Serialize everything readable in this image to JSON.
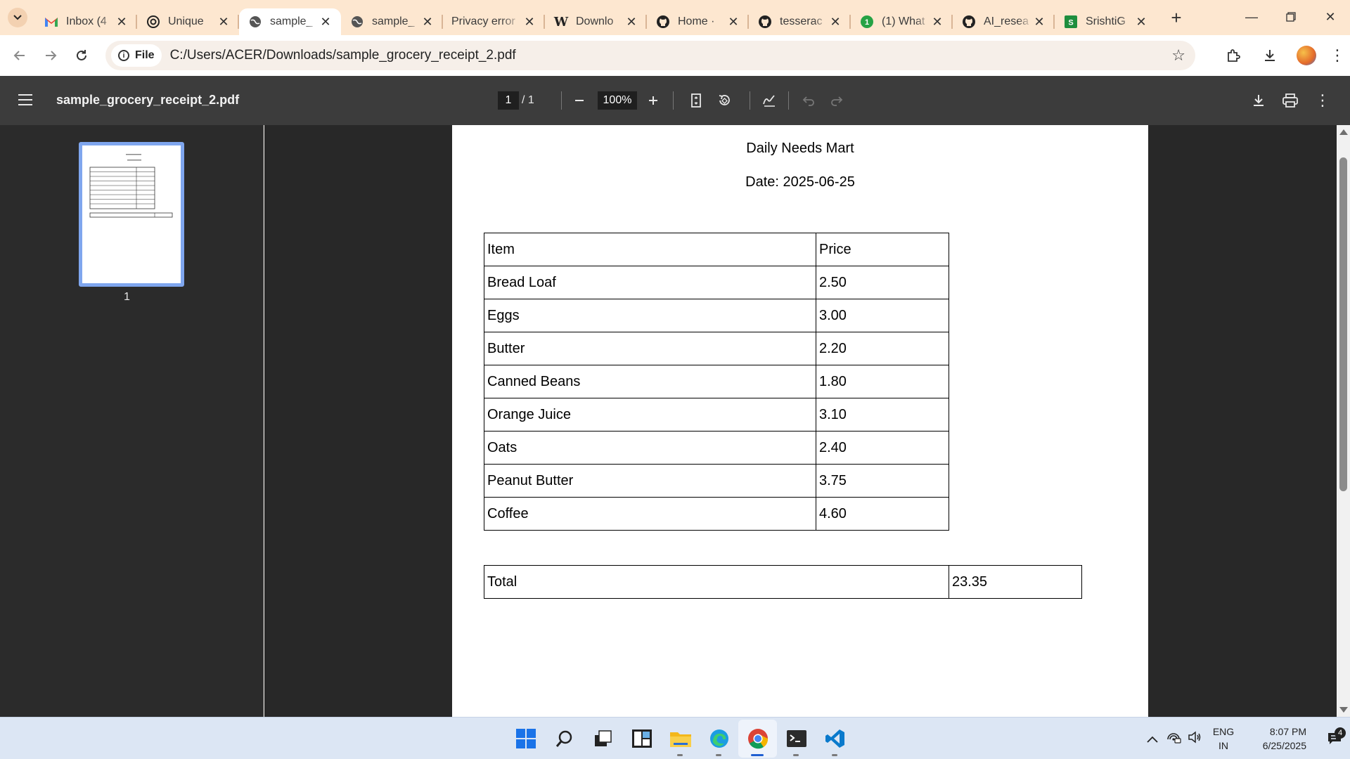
{
  "browser": {
    "tabs": [
      {
        "title": "Inbox (4",
        "favicon": "gmail-icon"
      },
      {
        "title": "Unique",
        "favicon": "openai-icon"
      },
      {
        "title": "sample_",
        "favicon": "globe-icon",
        "active": true
      },
      {
        "title": "sample_",
        "favicon": "globe-icon"
      },
      {
        "title": "Privacy error",
        "favicon": "none"
      },
      {
        "title": "Downlo",
        "favicon": "wikipedia-icon"
      },
      {
        "title": "Home · ",
        "favicon": "github-icon"
      },
      {
        "title": "tesserac",
        "favicon": "github-icon"
      },
      {
        "title": "(1) What",
        "favicon": "whatsapp-icon"
      },
      {
        "title": "AI_resea",
        "favicon": "github-icon"
      },
      {
        "title": "SrishtiG",
        "favicon": "sheets-icon"
      }
    ],
    "address": {
      "chip": "File",
      "url": "C:/Users/ACER/Downloads/sample_grocery_receipt_2.pdf"
    }
  },
  "viewer": {
    "filename": "sample_grocery_receipt_2.pdf",
    "page_current": "1",
    "page_total": "/  1",
    "zoom": "100%",
    "thumbnail_label": "1"
  },
  "receipt": {
    "store_name": "Daily Needs Mart",
    "date_line": "Date: 2025-06-25",
    "header": {
      "item": "Item",
      "price": "Price"
    },
    "rows": [
      {
        "item": "Bread Loaf",
        "price": "2.50"
      },
      {
        "item": "Eggs",
        "price": "3.00"
      },
      {
        "item": "Butter",
        "price": "2.20"
      },
      {
        "item": "Canned Beans",
        "price": "1.80"
      },
      {
        "item": "Orange Juice",
        "price": "3.10"
      },
      {
        "item": "Oats",
        "price": "2.40"
      },
      {
        "item": "Peanut Butter",
        "price": "3.75"
      },
      {
        "item": "Coffee",
        "price": "4.60"
      }
    ],
    "total_label": "Total",
    "total_value": "23.35"
  },
  "taskbar": {
    "lang_top": "ENG",
    "lang_bottom": "IN",
    "time": "8:07 PM",
    "date": "6/25/2025",
    "notification_count": "4"
  },
  "colors": {
    "tabstrip_bg": "#fde7d0",
    "viewer_bar": "#3c3c3c",
    "thumb_border": "#7fa6ee",
    "taskbar_bg": "#dce6f4"
  }
}
